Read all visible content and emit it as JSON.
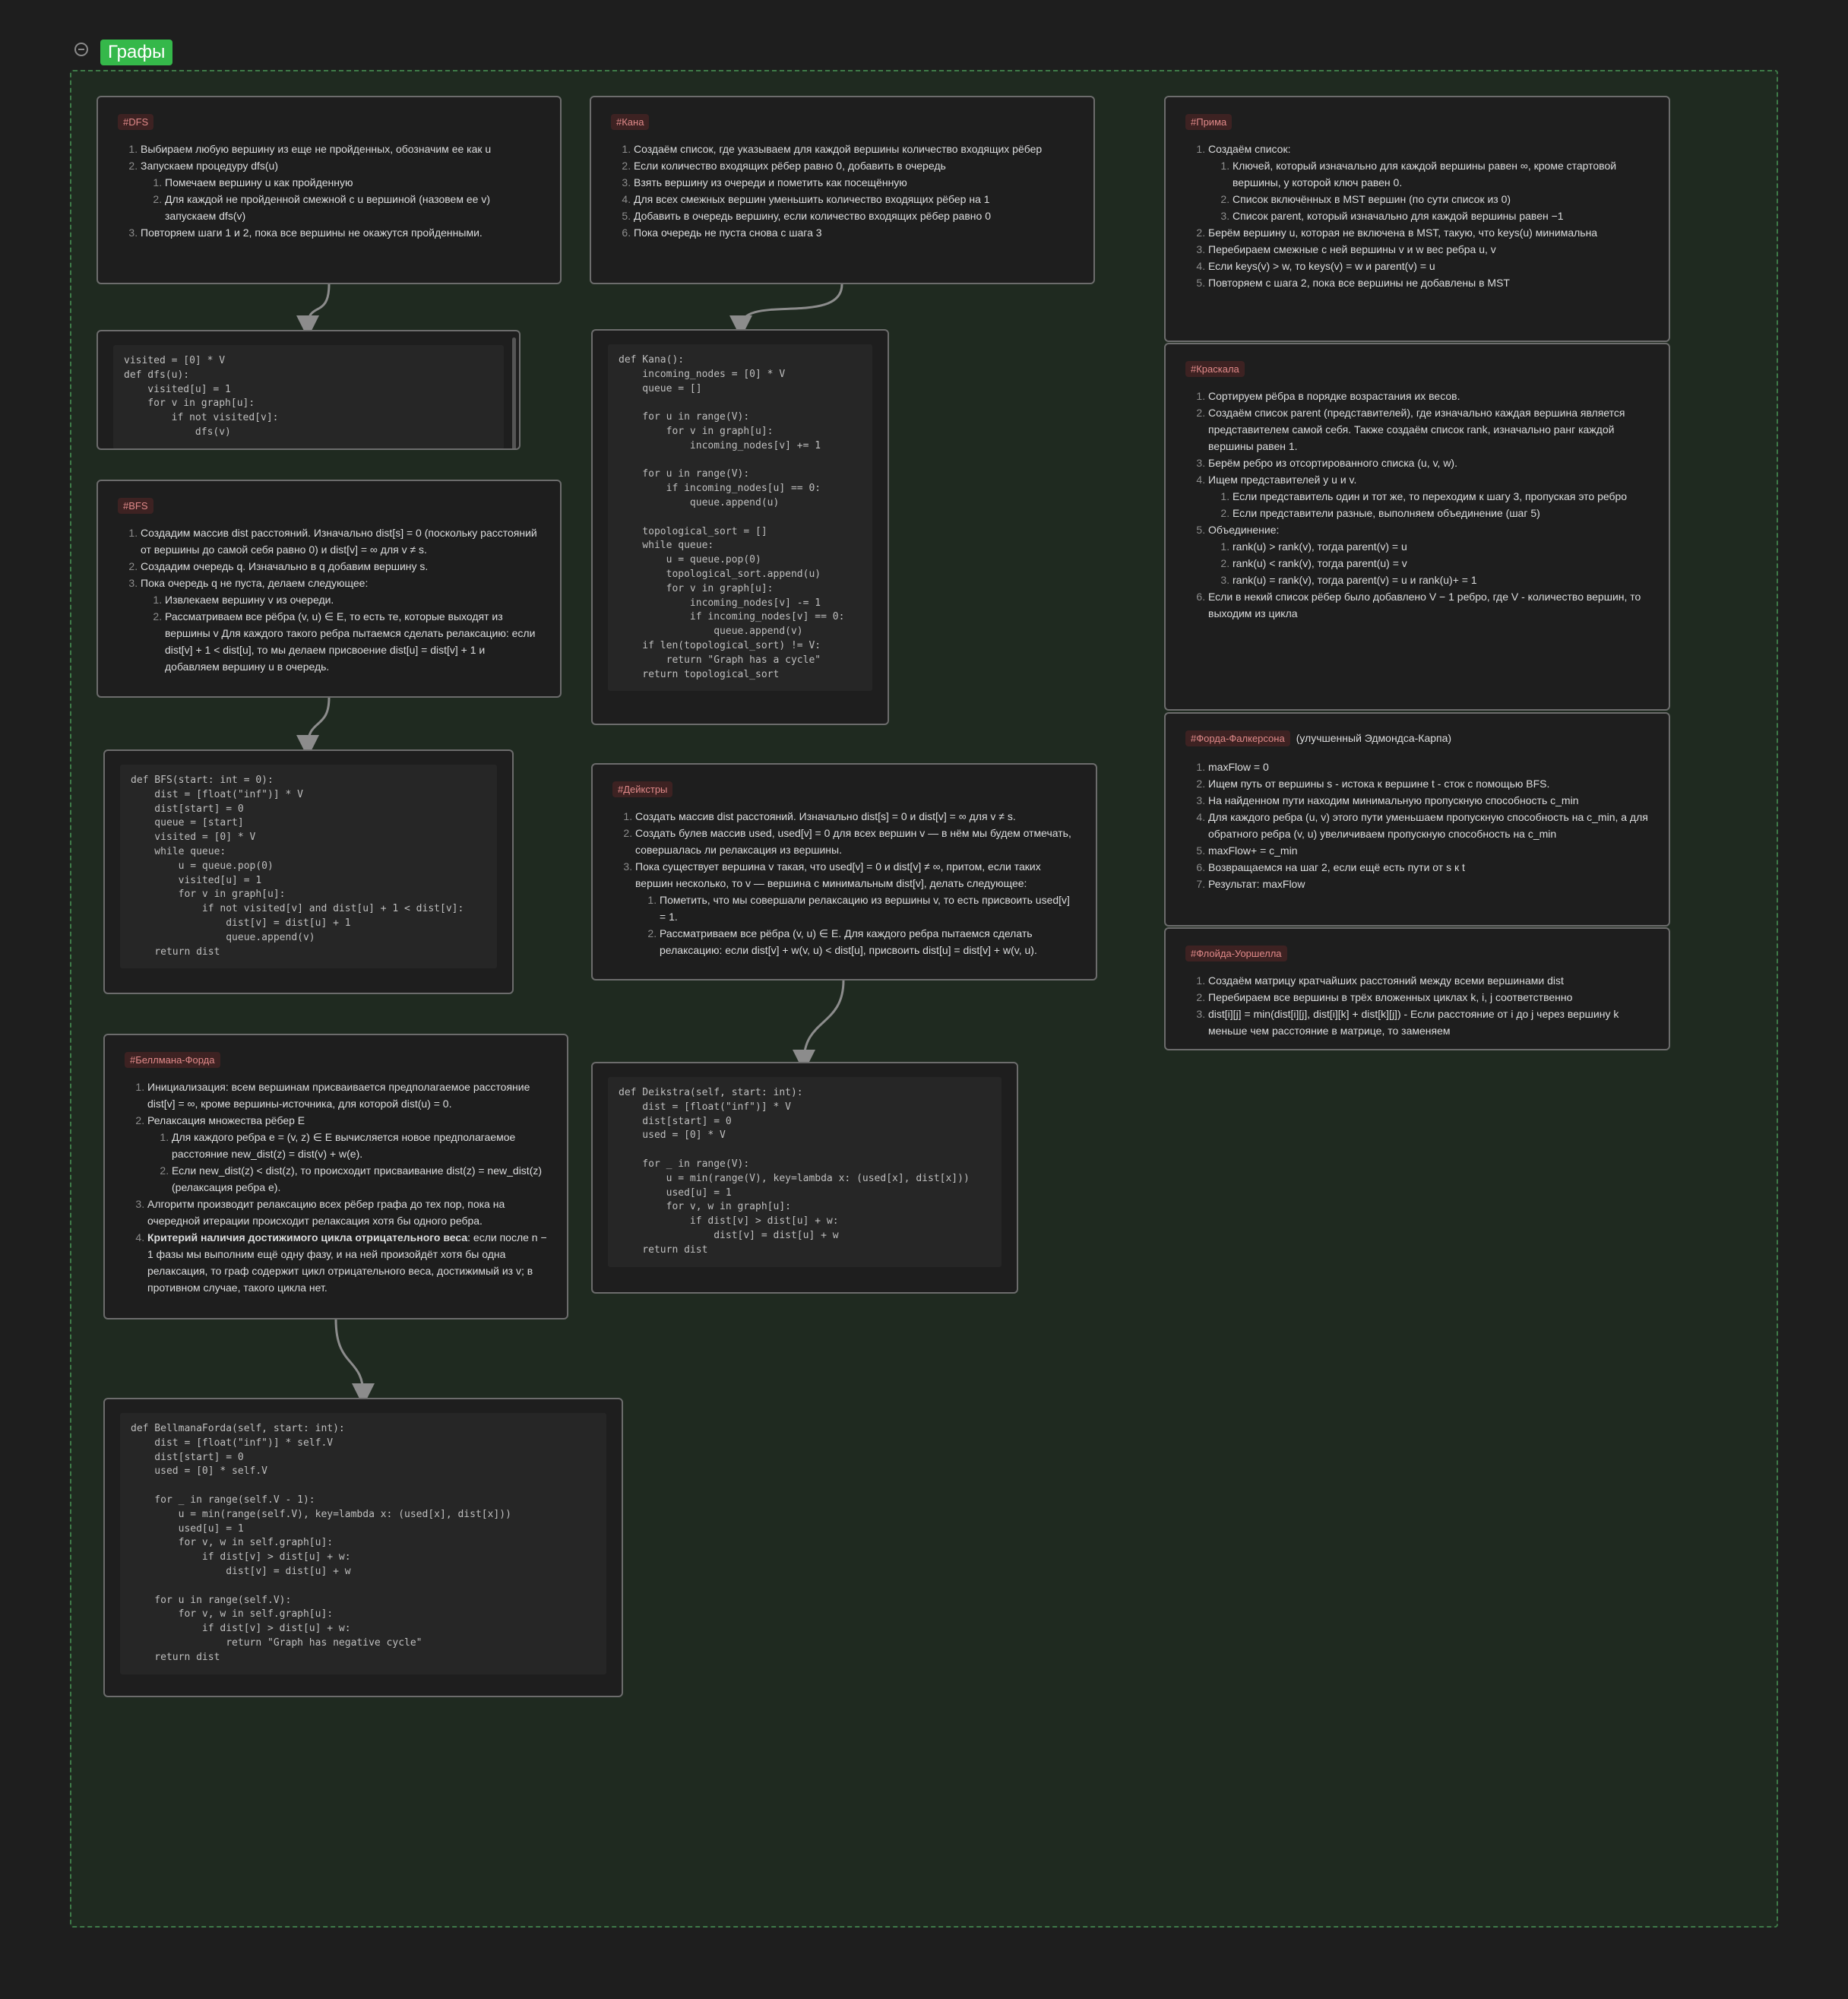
{
  "group": {
    "label": "Графы"
  },
  "cards": {
    "dfs": {
      "tag": "#DFS",
      "items": [
        "Выбираем любую вершину из еще не пройденных, обозначим ее как u",
        "Запускаем процедуру dfs(u)",
        "Повторяем шаги 1 и 2, пока все вершины не окажутся пройденными."
      ],
      "subitems": [
        "Помечаем вершину u как пройденную",
        "Для каждой не пройденной смежной с u вершиной (назовем ее v) запускаем dfs(v)"
      ]
    },
    "dfs_code": "visited = [0] * V\ndef dfs(u):\n    visited[u] = 1\n    for v in graph[u]:\n        if not visited[v]:\n            dfs(v)",
    "bfs": {
      "tag": "#BFS",
      "items": [
        "Создадим массив dist расстояний. Изначально dist[s] = 0 (поскольку расстояний от вершины до самой себя равно 0) и dist[v] = ∞ для v ≠ s.",
        "Создадим очередь q. Изначально в q добавим вершину s.",
        "Пока очередь q не пуста, делаем следующее:"
      ],
      "subitems": [
        "Извлекаем вершину v из очереди.",
        "Рассматриваем все рёбра (v, u) ∈ E, то есть те, которые выходят из вершины v Для каждого такого ребра пытаемся сделать релаксацию: если dist[v] + 1 < dist[u], то мы делаем присвоение dist[u] = dist[v] + 1 и добавляем вершину u в очередь."
      ]
    },
    "bfs_code": "def BFS(start: int = 0):\n    dist = [float(\"inf\")] * V\n    dist[start] = 0\n    queue = [start]\n    visited = [0] * V\n    while queue:\n        u = queue.pop(0)\n        visited[u] = 1\n        for v in graph[u]:\n            if not visited[v] and dist[u] + 1 < dist[v]:\n                dist[v] = dist[u] + 1\n                queue.append(v)\n    return dist",
    "bellman": {
      "tag": "#Беллмана-Форда",
      "items": [
        "Инициализация: всем вершинам присваивается предполагаемое расстояние dist[v] = ∞, кроме вершины-источника, для которой dist(u) = 0.",
        "Релаксация множества рёбер E",
        "Алгоритм производит релаксацию всех рёбер графа до тех пор, пока на очередной итерации происходит релаксация хотя бы одного ребра."
      ],
      "subitems": [
        "Для каждого ребра e = (v, z) ∈ E вычисляется новое предполагаемое расстояние new_dist(z) = dist(v) + w(e).",
        "Если new_dist(z) < dist(z), то происходит присваивание dist(z) = new_dist(z) (релаксация ребра e)."
      ],
      "item4_bold": "Критерий наличия достижимого цикла отрицательного веса",
      "item4_rest": ": если после n − 1 фазы мы выполним ещё одну фазу, и на ней произойдёт хотя бы одна релаксация, то граф содержит цикл отрицательного веса, достижимый из v; в противном случае, такого цикла нет."
    },
    "bellman_code": "def BellmanaForda(self, start: int):\n    dist = [float(\"inf\")] * self.V\n    dist[start] = 0\n    used = [0] * self.V\n\n    for _ in range(self.V - 1):\n        u = min(range(self.V), key=lambda x: (used[x], dist[x]))\n        used[u] = 1\n        for v, w in self.graph[u]:\n            if dist[v] > dist[u] + w:\n                dist[v] = dist[u] + w\n\n    for u in range(self.V):\n        for v, w in self.graph[u]:\n            if dist[v] > dist[u] + w:\n                return \"Graph has negative cycle\"\n    return dist",
    "kana": {
      "tag": "#Кана",
      "items": [
        "Создаём список, где указываем для каждой вершины количество входящих рёбер",
        "Если количество входящих рёбер равно 0, добавить в очередь",
        "Взять вершину из очереди и пометить как посещённую",
        "Для всех смежных вершин уменьшить количество входящих рёбер на 1",
        "Добавить в очередь вершину, если количество входящих рёбер равно 0",
        "Пока очередь не пуста снова с шага 3"
      ]
    },
    "kana_code": "def Kana():\n    incoming_nodes = [0] * V\n    queue = []\n\n    for u in range(V):\n        for v in graph[u]:\n            incoming_nodes[v] += 1\n\n    for u in range(V):\n        if incoming_nodes[u] == 0:\n            queue.append(u)\n\n    topological_sort = []\n    while queue:\n        u = queue.pop(0)\n        topological_sort.append(u)\n        for v in graph[u]:\n            incoming_nodes[v] -= 1\n            if incoming_nodes[v] == 0:\n                queue.append(v)\n    if len(topological_sort) != V:\n        return \"Graph has a cycle\"\n    return topological_sort",
    "dijkstra": {
      "tag": "#Дейкстры",
      "items": [
        "Создать массив dist расстояний. Изначально dist[s] = 0 и dist[v] = ∞ для v ≠ s.",
        "Создать булев массив used, used[v] = 0 для всех вершин v — в нём мы будем отмечать, совершалась ли релаксация из вершины.",
        "Пока существует вершина v такая, что used[v] = 0 и dist[v] ≠ ∞, притом, если таких вершин несколько, то v — вершина с минимальным dist[v], делать следующее:"
      ],
      "subitems": [
        "Пометить, что мы совершали релаксацию из вершины v, то есть присвоить used[v] = 1.",
        "Рассматриваем все рёбра (v, u) ∈ E. Для каждого ребра пытаемся сделать релаксацию: если dist[v] + w(v, u) < dist[u], присвоить dist[u] = dist[v] + w(v, u)."
      ]
    },
    "dijkstra_code": "def Deikstra(self, start: int):\n    dist = [float(\"inf\")] * V\n    dist[start] = 0\n    used = [0] * V\n\n    for _ in range(V):\n        u = min(range(V), key=lambda x: (used[x], dist[x]))\n        used[u] = 1\n        for v, w in graph[u]:\n            if dist[v] > dist[u] + w:\n                dist[v] = dist[u] + w\n    return dist",
    "prima": {
      "tag": "#Прима",
      "items": [
        "Создаём список:",
        "Берём вершину u, которая не включена в MST, такую, что keys(u) минимальна",
        "Перебираем смежные с ней вершины v и w вес ребра u, v",
        "Если keys(v) > w, то keys(v) = w и parent(v) = u",
        "Повторяем с шага 2, пока все вершины не добавлены в MST"
      ],
      "subitems": [
        "Ключей, который изначально для каждой вершины равен ∞, кроме стартовой вершины, у которой ключ равен 0.",
        "Список включённых в MST вершин (по сути список из 0)",
        "Список parent, который изначально для каждой вершины равен −1"
      ]
    },
    "kraskal": {
      "tag": "#Краскала",
      "items": [
        "Сортируем рёбра в порядке возрастания их весов.",
        "Создаём список parent (представителей), где изначально каждая вершина является представителем самой себя. Также создаём список rank, изначально ранг каждой вершины равен 1.",
        "Берём ребро из отсортированного списка (u, v, w).",
        "Ищем представителей у u и v.",
        "Объединение:",
        "Если в некий список рёбер было добавлено V − 1 ребро, где V - количество вершин, то выходим из цикла"
      ],
      "subitems4": [
        "Если представитель один и тот же, то переходим к шагу 3, пропуская это ребро",
        "Если представители разные, выполняем объединение (шаг 5)"
      ],
      "subitems5": [
        "rank(u) > rank(v), тогда parent(v) = u",
        "rank(u) < rank(v), тогда parent(u) = v",
        "rank(u) = rank(v), тогда parent(v) = u и rank(u)+ = 1"
      ]
    },
    "ford": {
      "tag": "#Форда-Фалкерсона",
      "extra": "(улучшенный Эдмондса-Карпа)",
      "items": [
        "maxFlow = 0",
        "Ищем путь от вершины s - истока к вершине t - сток с помощью BFS.",
        "На найденном пути находим минимальную пропускную способность c_min",
        "Для каждого ребра (u, v) этого пути уменьшаем пропускную способность на c_min, а для обратного ребра (v, u) увеличиваем пропускную способность на c_min",
        "maxFlow+ = c_min",
        "Возвращаемся на шаг 2, если ещё есть пути от s к t",
        "Результат: maxFlow"
      ]
    },
    "floyd": {
      "tag": "#Флойда-Уоршелла",
      "items": [
        "Создаём матрицу кратчайших расстояний между всеми вершинами dist",
        "Перебираем все вершины в трёх вложенных циклах k, i, j соответственно",
        "dist[i][j] = min(dist[i][j], dist[i][k] + dist[k][j]) - Если расстояние от i до j через вершину k меньше чем расстояние в матрице, то заменяем"
      ]
    }
  }
}
